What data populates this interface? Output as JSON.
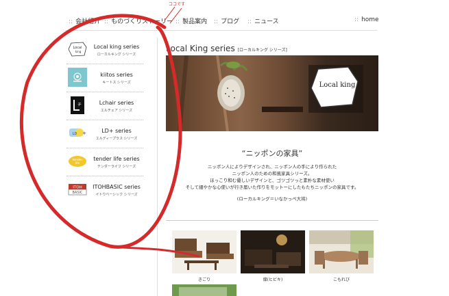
{
  "callout": "ココです",
  "nav": {
    "items": [
      {
        "label": "会社紹介"
      },
      {
        "label": "ものづくりストーリー"
      },
      {
        "label": "製品案内"
      },
      {
        "label": "ブログ"
      },
      {
        "label": "ニュース"
      },
      {
        "label": "home"
      }
    ]
  },
  "sidebar": {
    "items": [
      {
        "title": "Local king series",
        "sub": "ローカルキング シリーズ",
        "logo": "Local king"
      },
      {
        "title": "kiitos series",
        "sub": "キートス シリーズ",
        "logo": "kiitos"
      },
      {
        "title": "Lchair series",
        "sub": "エルチェア シリーズ",
        "logo": "Lチェア"
      },
      {
        "title": "LD+ series",
        "sub": "エルディープラス シリーズ",
        "logo": "LD+"
      },
      {
        "title": "tender life series",
        "sub": "テンダーライフ シリーズ",
        "logo": "tender life"
      },
      {
        "title": "ITOHBASIC series",
        "sub": "イトウベーシック シリーズ",
        "logo": "ITOH BASIC"
      }
    ]
  },
  "main": {
    "title": "Local King series",
    "title_sub": "[ローカルキング シリーズ]",
    "hero_logo": "Local king",
    "slogan": "“ニッポンの家具”",
    "desc": [
      "ニッポン人によりデザインされ、ニッポン人の手により作られた",
      "ニッポン人のための和風家具シリーズ。",
      "ほっこり和む優しいデザインと、ゴツゴツっと素朴な素材使い",
      "そして細やかな心使いが行き届いた作りをモットーにしたもたちニッポンの家具です。"
    ],
    "note": "(ローカルキング＝いなかっぺ大将)",
    "products": [
      {
        "caption": "きごり"
      },
      {
        "caption": "燦(ヒビキ)"
      },
      {
        "caption": "こもれび"
      }
    ]
  },
  "colors": {
    "accent_red": "#d42a2a",
    "text": "#333333"
  }
}
